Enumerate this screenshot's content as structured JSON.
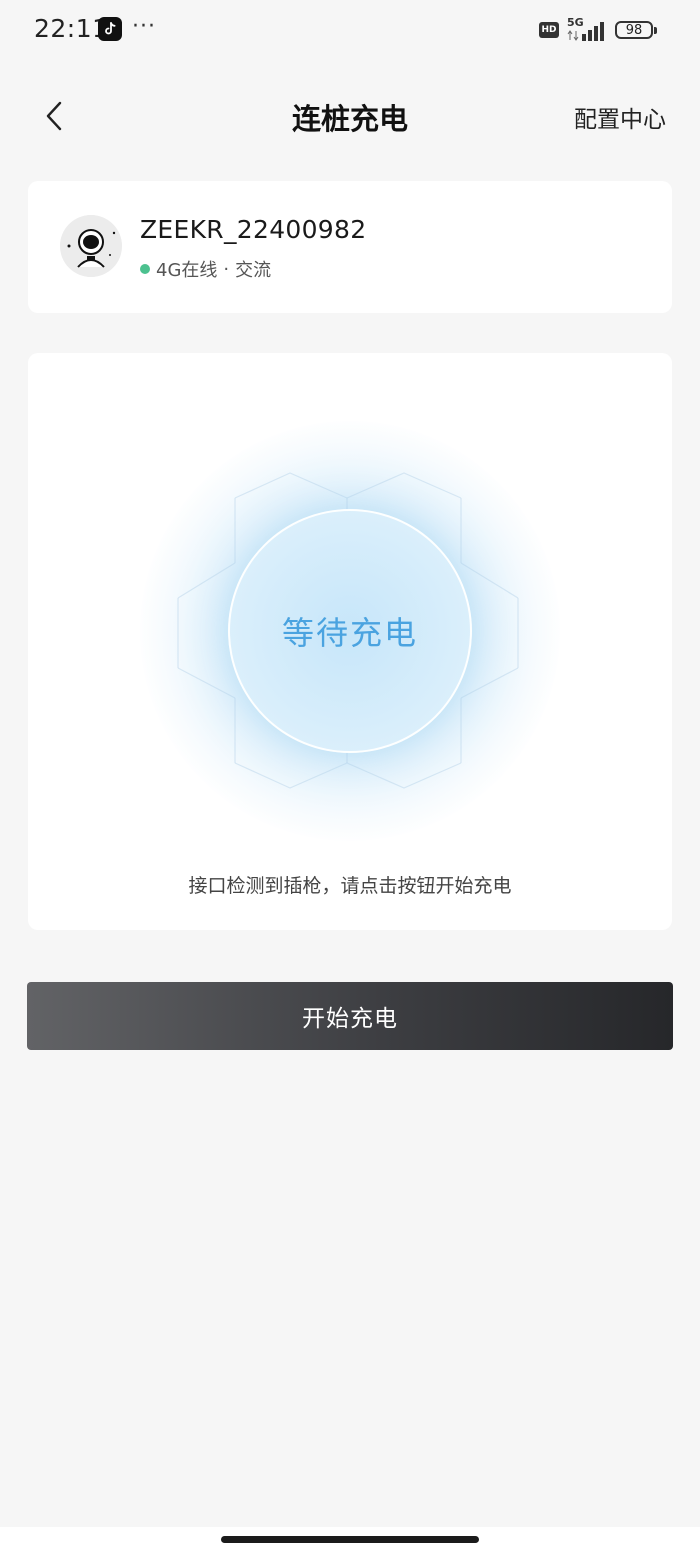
{
  "status_bar": {
    "time": "22:11",
    "more": "···",
    "hd": "HD",
    "network": "5G",
    "battery": "98"
  },
  "nav": {
    "title": "连桩充电",
    "right_link": "配置中心"
  },
  "device": {
    "name": "ZEEKR_22400982",
    "network_status": "4G在线",
    "separator": "·",
    "current_type": "交流"
  },
  "charge": {
    "status": "等待充电",
    "hint": "接口检测到插枪，请点击按钮开始充电"
  },
  "actions": {
    "start_label": "开始充电"
  },
  "colors": {
    "accent": "#4aa3e0",
    "online": "#4cc18f",
    "button_dark": "#26272a"
  }
}
